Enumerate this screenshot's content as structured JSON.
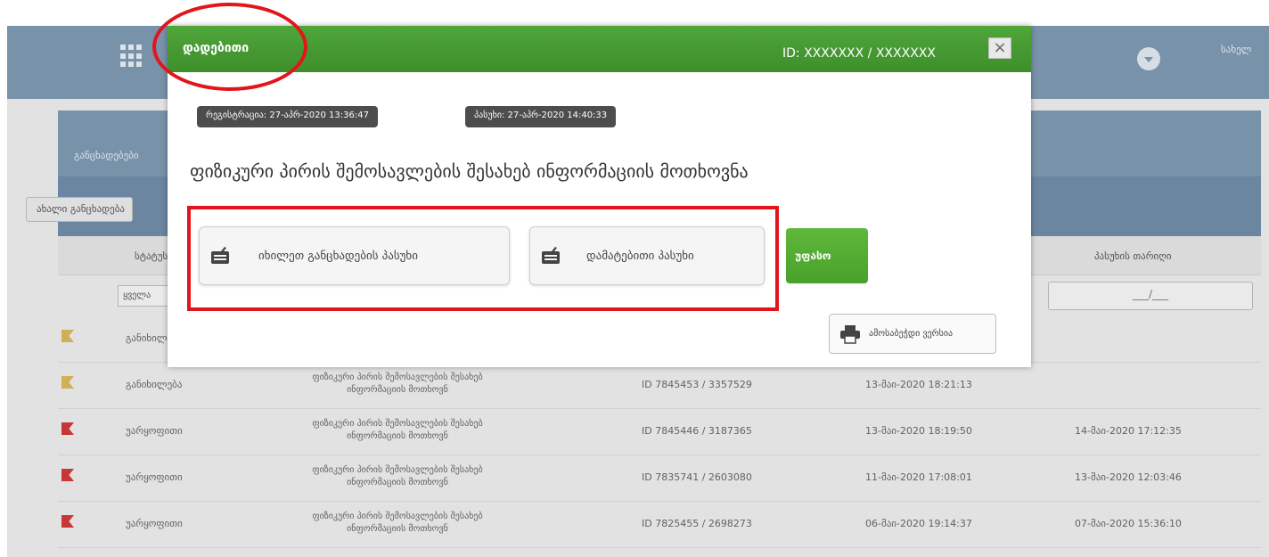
{
  "topbar": {
    "user_label": "სახელ"
  },
  "panel": {
    "title": "განცხადებები",
    "new_button_label": "ახალი განცხადება"
  },
  "table": {
    "columns": [
      "სტატუსი",
      "პასუხის თარიღი"
    ],
    "status_filter": "ყველა",
    "date_filter": "___/___",
    "rows": [
      {
        "status": "განიხილება",
        "flag": "#d7b85a",
        "title_line1": "",
        "title_line2": "",
        "id": "",
        "registered": "",
        "answered": ""
      },
      {
        "status": "განიხილება",
        "flag": "#d7b85a",
        "title_line1": "ფიზიკური პირის შემოსავლების შესახებ",
        "title_line2": "ინფორმაციის მოთხოვნ",
        "id": "ID 7845453 / 3357529",
        "registered": "13-მაი-2020 18:21:13",
        "answered": ""
      },
      {
        "status": "უარყოფითი",
        "flag": "#d03a3a",
        "title_line1": "ფიზიკური პირის შემოსავლების შესახებ",
        "title_line2": "ინფორმაციის მოთხოვნ",
        "id": "ID 7845446 / 3187365",
        "registered": "13-მაი-2020 18:19:50",
        "answered": "14-მაი-2020 17:12:35"
      },
      {
        "status": "უარყოფითი",
        "flag": "#d03a3a",
        "title_line1": "ფიზიკური პირის შემოსავლების შესახებ",
        "title_line2": "ინფორმაციის მოთხოვნ",
        "id": "ID 7835741 / 2603080",
        "registered": "11-მაი-2020 17:08:01",
        "answered": "13-მაი-2020 12:03:46"
      },
      {
        "status": "უარყოფითი",
        "flag": "#d03a3a",
        "title_line1": "ფიზიკური პირის შემოსავლების შესახებ",
        "title_line2": "ინფორმაციის მოთხოვნ",
        "id": "ID 7825455 / 2698273",
        "registered": "06-მაი-2020 19:14:37",
        "answered": "07-მაი-2020 15:36:10"
      }
    ]
  },
  "modal": {
    "title": "დადებითი",
    "id_text": "ID: XXXXXXX / XXXXXXX",
    "close_glyph": "×",
    "registration_badge": "რეგისტრაცია: 27-აპრ-2020 13:36:47",
    "answer_badge": "პასუხი: 27-აპრ-2020 14:40:33",
    "request_title": "ფიზიკური პირის შემოსავლების შესახებ ინფორმაციის მოთხოვნა",
    "view_answer_label": "იხილეთ განცხადების პასუხი",
    "additional_answer_label": "დამატებითი პასუხი",
    "empty_label": "უფასო",
    "print_label": "ამოსაბეჭდი ვერსია"
  },
  "colors": {
    "header_green": "#4fa53a",
    "highlight_red": "#e2151b",
    "topbar_blue": "#7d98b1"
  }
}
